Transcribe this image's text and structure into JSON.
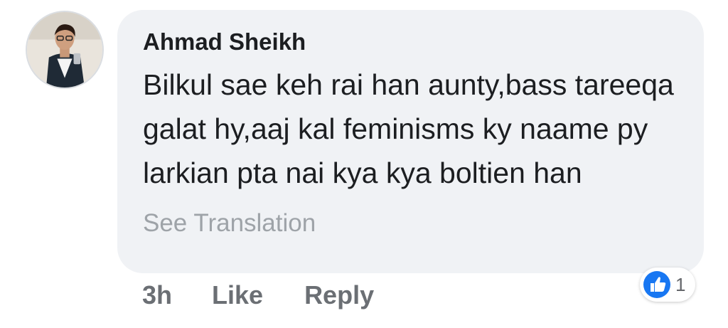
{
  "comment": {
    "author": "Ahmad Sheikh",
    "text": "Bilkul sae keh rai han aunty,bass tareeqa galat hy,aaj kal feminisms ky naame py larkian pta nai kya kya boltien han",
    "see_translation": "See Translation",
    "timestamp": "3h",
    "like_label": "Like",
    "reply_label": "Reply",
    "reaction": {
      "icon": "thumbs-up-icon",
      "count": "1",
      "color": "#1877f2"
    }
  },
  "colors": {
    "bubble": "#f0f2f5",
    "text": "#1c1e21",
    "muted": "#6b6f74",
    "translation": "#9ea3a8"
  }
}
